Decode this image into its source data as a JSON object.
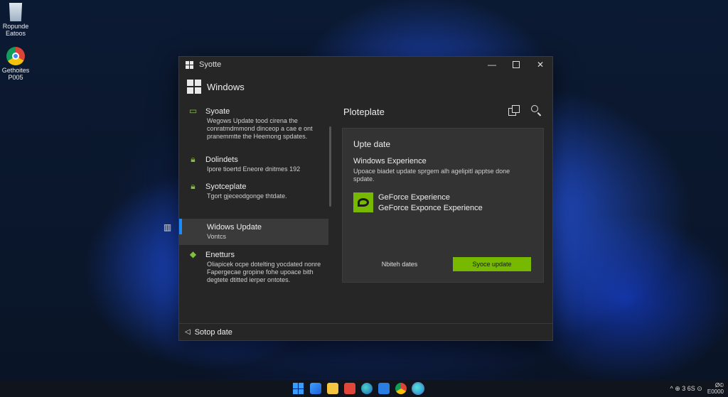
{
  "desktop": {
    "icons": [
      {
        "label_line1": "Ropunde",
        "label_line2": "Eatoos",
        "icon": "recycle-bin-icon"
      },
      {
        "label_line1": "Gethoites",
        "label_line2": "P005",
        "icon": "chrome-icon"
      }
    ]
  },
  "window": {
    "title": "Syotte",
    "controls": {
      "minimize": "—",
      "close": "✕"
    },
    "header_title": "Windows",
    "sidebar": {
      "items": [
        {
          "title": "Syoate",
          "desc": "Wegows Update tood cirena the conratmdmmond dinceop a cae e ont pranemmtte the Heemong spdates.",
          "icon": "monitor-icon"
        },
        {
          "title": "Dolindets",
          "desc": "Ipore tioertd Eneore dnitmes 192",
          "icon": "lock-icon"
        },
        {
          "title": "Syotceplate",
          "desc": "Tgort gjeceodgonge thtdate.",
          "icon": "lock-icon"
        },
        {
          "title": "Widows Update",
          "desc": "Vontcs",
          "icon": "windows-update-icon"
        },
        {
          "title": "Enetturs",
          "desc": "Oliapicek ocpe dotelting yocdated nonre Fapergecae gropine fohe upoace bith degtete dtitted ierper ontotes.",
          "icon": "tag-icon"
        }
      ]
    },
    "main": {
      "title": "Ploteplate",
      "card": {
        "title": "Upte date",
        "subtitle": "Windows Experience",
        "desc": "Upoace biadet update sprgem alh agelipitl apptse done spdate.",
        "app_name_1": "GeForce Experience",
        "app_name_2": "GeForce Exponce Experience",
        "secondary_button": "Nbiteh dates",
        "primary_button": "Syoce update"
      }
    },
    "footer": {
      "label": "Sotop date",
      "back_icon": "◁"
    }
  },
  "taskbar": {
    "tray_text": "^ ⊕ 3 6S ⊙",
    "time_line1": "Ø©",
    "time_line2": "E0000"
  },
  "colors": {
    "accent_green": "#76b900",
    "accent_blue": "#1a8cff",
    "window_bg": "#262626",
    "card_bg": "#333333"
  }
}
